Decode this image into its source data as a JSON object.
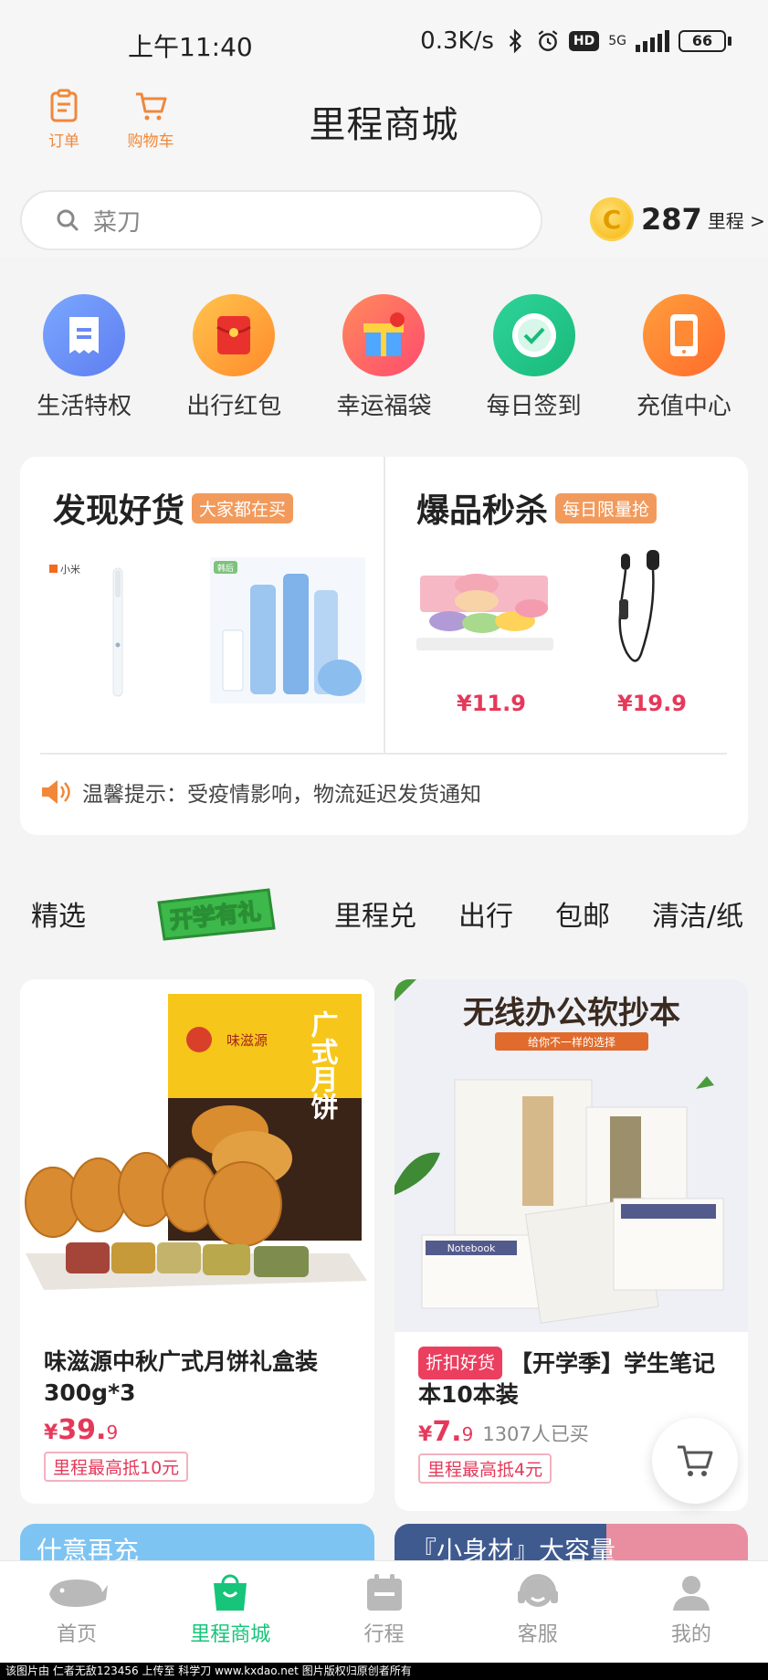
{
  "status_bar": {
    "time": "上午11:40",
    "network_speed": "0.3K/s",
    "hd": "HD",
    "network": "5G",
    "battery": "66"
  },
  "header": {
    "title": "里程商城",
    "orders_label": "订单",
    "cart_label": "购物车"
  },
  "search": {
    "placeholder": "菜刀"
  },
  "miles": {
    "value": "287",
    "unit": "里程 >"
  },
  "quick_actions": [
    {
      "label": "生活特权",
      "icon": "ticket-icon"
    },
    {
      "label": "出行红包",
      "icon": "red-envelope-icon"
    },
    {
      "label": "幸运福袋",
      "icon": "gift-box-icon"
    },
    {
      "label": "每日签到",
      "icon": "check-in-icon"
    },
    {
      "label": "充值中心",
      "icon": "phone-recharge-icon"
    }
  ],
  "promo": {
    "left": {
      "title": "发现好货",
      "tag": "大家都在买",
      "brand_label": "小米",
      "brand_tag": "韩后"
    },
    "right": {
      "title": "爆品秒杀",
      "tag": "每日限量抢",
      "prices": [
        "¥11.9",
        "¥19.9"
      ]
    },
    "notice": "温馨提示：受疫情影响，物流延迟发货通知"
  },
  "tabs": {
    "items": [
      "精选",
      "开学有礼",
      "里程兑",
      "出行",
      "包邮",
      "清洁/纸"
    ]
  },
  "products": [
    {
      "name": "味滋源中秋广式月饼礼盒装300g*3",
      "price_symbol": "¥",
      "price_main": "39.",
      "price_decimal": "9",
      "deduct": "里程最高抵10元",
      "image_brand": "味滋源",
      "image_text": "广式月饼"
    },
    {
      "badge": "折扣好货",
      "name": "【开学季】学生笔记本10本装",
      "price_symbol": "¥",
      "price_main": "7.",
      "price_decimal": "9",
      "sold": "1307人已买",
      "deduct": "里程最高抵4元",
      "image_title": "无线办公软抄本",
      "image_subtitle": "给你不一样的选择",
      "notebook_label": "Notebook"
    }
  ],
  "peek": {
    "left": "什意再充",
    "right": "『小身材』大容量"
  },
  "bottom_nav": [
    {
      "label": "首页",
      "active": false
    },
    {
      "label": "里程商城",
      "active": true
    },
    {
      "label": "行程",
      "active": false
    },
    {
      "label": "客服",
      "active": false
    },
    {
      "label": "我的",
      "active": false
    }
  ],
  "footer": "该图片由 仁者无敌123456 上传至 科学刀 www.kxdao.net 图片版权归原创者所有",
  "colors": {
    "accent_orange": "#f0883a",
    "price_red": "#e5395a",
    "active_green": "#16c57a"
  }
}
